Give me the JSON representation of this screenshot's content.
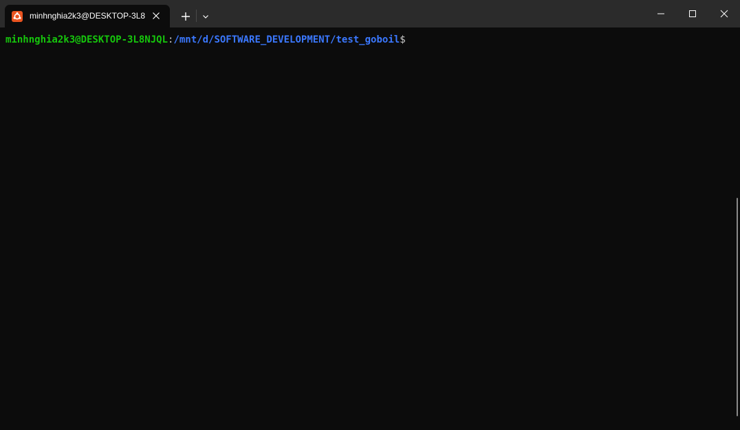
{
  "tab": {
    "title": "minhnghia2k3@DESKTOP-3L8",
    "icon": "ubuntu-icon",
    "icon_color": "#e95420"
  },
  "titlebar": {
    "new_tab_icon": "plus-icon",
    "dropdown_icon": "chevron-down-icon",
    "minimize_icon": "minimize-icon",
    "maximize_icon": "maximize-icon",
    "close_icon": "close-icon"
  },
  "terminal": {
    "prompt": {
      "user_host": "minhnghia2k3@DESKTOP-3L8NJQL",
      "separator": ":",
      "path": "/mnt/d/SOFTWARE_DEVELOPMENT/test_goboil",
      "symbol": "$"
    },
    "colors": {
      "user_host": "#16c60c",
      "path": "#3b78ff",
      "background": "#0c0c0c"
    }
  }
}
